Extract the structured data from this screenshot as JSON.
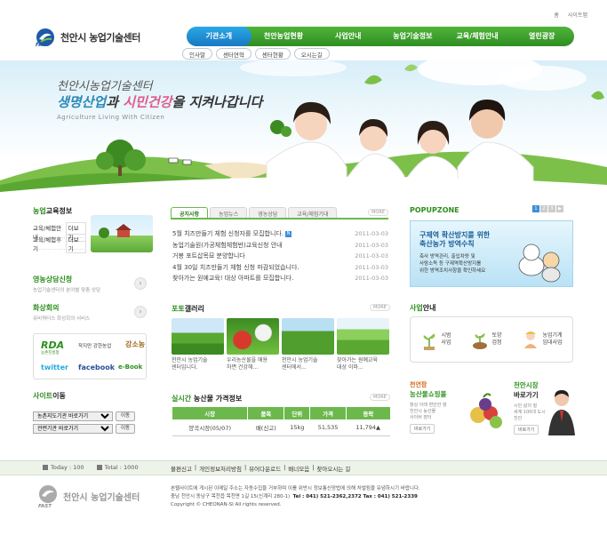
{
  "util": {
    "home": "홈",
    "sitemap": "사이트맵"
  },
  "logo": {
    "name": "천안시 농업기술센터",
    "fast": "FAST"
  },
  "gnb": [
    {
      "label": "기관소개"
    },
    {
      "label": "천안농업현황"
    },
    {
      "label": "사업안내"
    },
    {
      "label": "농업기술정보"
    },
    {
      "label": "교육/체험안내"
    },
    {
      "label": "열린광장"
    }
  ],
  "subnav": [
    "인사말",
    "센터연혁",
    "센터현황",
    "오시는길"
  ],
  "hero": {
    "slogan1": "천안시농업기술센터",
    "slogan2a": "생명산업",
    "slogan2b": "과 ",
    "slogan2c": "시민건강",
    "slogan2d": "을 지켜나갑니다",
    "slogan3": "Agriculture Living With Citizen"
  },
  "edu": {
    "title_green": "농업",
    "title_dark": "교육정보",
    "rows": [
      {
        "label": "교육/체험안내",
        "more": "더보기"
      },
      {
        "label": "교육/체험후기",
        "more": "더보기"
      }
    ]
  },
  "farm": {
    "title": "영농상담신청",
    "sub": "농업기술센터의 분야별 맞춤 상담"
  },
  "hwa": {
    "title": "화상회의",
    "sub": "유비쿼터스 화상회의 서비스"
  },
  "banner": {
    "rda": "RDA",
    "rda_sub": "농촌진흥청",
    "rda_txt": "작지만 강한농업",
    "kw": "강소농",
    "twitter": "twitter",
    "facebook": "facebook",
    "ebook": "e-Book"
  },
  "site": {
    "title_green": "사이트",
    "title_dark": "이동",
    "selects": [
      {
        "value": "농촌지도기관 바로가기",
        "btn": "이동"
      },
      {
        "value": "관련기관 바로가기",
        "btn": "이동"
      }
    ]
  },
  "tabs": [
    "공지사항",
    "농업뉴스",
    "영농상담",
    "교육/체험기대"
  ],
  "tabs_more": "MORE",
  "news": [
    {
      "t": "5월 치즈만들기 체험 신청자를 모집합니다.",
      "d": "2011-03-03",
      "new": "N"
    },
    {
      "t": "농업기술원(가공체험체험반)교육신청 안내",
      "d": "2011-03-03",
      "new": ""
    },
    {
      "t": "거봉 포트삽목묘 분양합니다",
      "d": "2011-03-03",
      "new": ""
    },
    {
      "t": "4월 30일 치즈만들기 체험 신청 마감되었습니다.",
      "d": "2011-03-03",
      "new": ""
    },
    {
      "t": "찾아가는 원예교육! 대상 아파트를 모집합니다.",
      "d": "2011-03-03",
      "new": ""
    }
  ],
  "gallery": {
    "title_green": "포토",
    "title_dark": "갤러리",
    "more": "MORE",
    "items": [
      {
        "cap1": "천안시 농업기술",
        "cap2": "센터입니다."
      },
      {
        "cap1": "우리농산물을 애용",
        "cap2": "하면 건강해..."
      },
      {
        "cap1": "천안시 농업기술",
        "cap2": "센터에서..."
      },
      {
        "cap1": "찾아가는 원예교육",
        "cap2": "대상 이파..."
      }
    ]
  },
  "price": {
    "title_green": "실시간",
    "title_dark": " 농산물 가격정보",
    "more": "MORE",
    "headers": [
      "시장",
      "품목",
      "단위",
      "가격",
      "등락"
    ],
    "rows": [
      [
        "양곡시장(05/07)",
        "배(신고)",
        "15kg",
        "51,535",
        "11,794▲"
      ]
    ]
  },
  "popup": {
    "title": "POPUPZONE",
    "pages": [
      "1",
      "2",
      "3",
      "▶"
    ],
    "h1a": "구제역 확산방지를 위한",
    "h1b": "축산농가 방역수칙",
    "b1": "축사 방역관리, 출입차량 및",
    "b2": "사람소독 등 구제역확산방지를",
    "b3": "위한 방역조치사항을 확인하세요"
  },
  "biz": {
    "title_green": "사업",
    "title_dark": "안내",
    "items": [
      {
        "a": "시범",
        "b": "사업",
        "color": "#8bc34a"
      },
      {
        "a": "토양",
        "b": "검정",
        "color": "#c8a060"
      },
      {
        "a": "농업기계",
        "b": "임대사업",
        "color": "#f0b27a"
      }
    ]
  },
  "shop": {
    "t1": "천연팜",
    "t2": "농산물쇼핑몰",
    "d1": "항상 아래 편안한 항",
    "d2": "천안시 농산물",
    "d3": "사이버 장터",
    "btn": "바로가기"
  },
  "mayor": {
    "t1": "천안시장",
    "t2": "바로가기",
    "d1": "시민 삶의 질",
    "d2": "세계 100대 도시",
    "d3": "천안",
    "btn": "바로가기"
  },
  "footer": {
    "today_label": "Today : 100",
    "total_label": "Total : 1000",
    "links": [
      "불편신고",
      "|",
      "개인정보처리방침",
      "|",
      "뷰어다운로드",
      "|",
      "배너모음",
      "|",
      "찾아오시는 길"
    ],
    "logo_name": "천안시 농업기술센터",
    "fast": "FAST",
    "info1": "본웹사이트에 게시된 이메일 주소는 자동수집을 거부하며 이를 위반시 정보통신망법에 의해 처벌됨을 유념하시기 바랍니다.",
    "info2a": "충남 천안시 동남구 목천읍 목천면 1길 15(신계리 280-1)",
    "info2b": "Tel : 041) 521-2362,2372   Tax : 041) 521-2339",
    "copy": "Copyright © CHEONAN-SI All rights reserved."
  }
}
